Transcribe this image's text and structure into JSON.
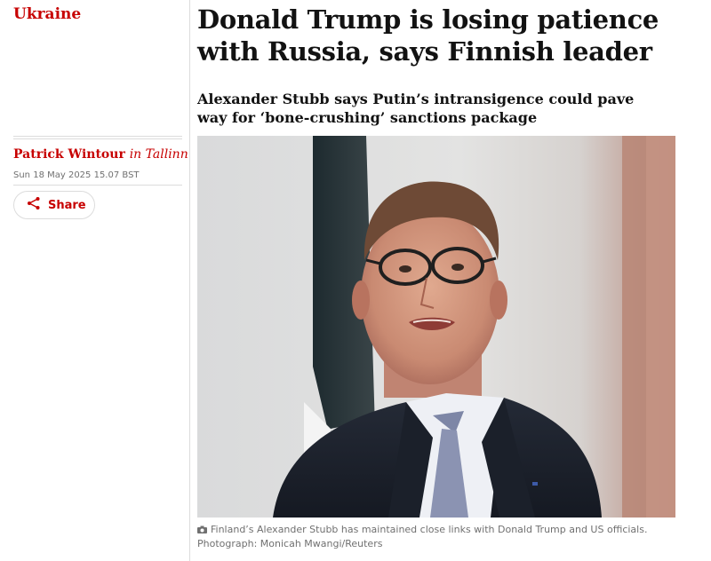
{
  "section": {
    "label": "Ukraine"
  },
  "article": {
    "headline": "Donald Trump is losing patience with Russia, says Finnish leader",
    "standfirst": "Alexander Stubb says Putin’s intransigence could pave way for ‘bone-crushing’ sanctions package"
  },
  "byline": {
    "author": "Patrick Wintour",
    "location": "in Tallinn"
  },
  "dateline": "Sun 18 May 2025 15.07 BST",
  "share": {
    "label": "Share",
    "icon": "share-icon"
  },
  "image": {
    "caption": "Finland’s Alexander Stubb has maintained close links with Donald Trump and US officials.",
    "credit": "Photograph: Monicah Mwangi/Reuters",
    "icon": "camera-icon"
  },
  "colors": {
    "accent": "#c70000",
    "text": "#121212",
    "muted": "#707070",
    "rule": "#dcdcdc"
  }
}
